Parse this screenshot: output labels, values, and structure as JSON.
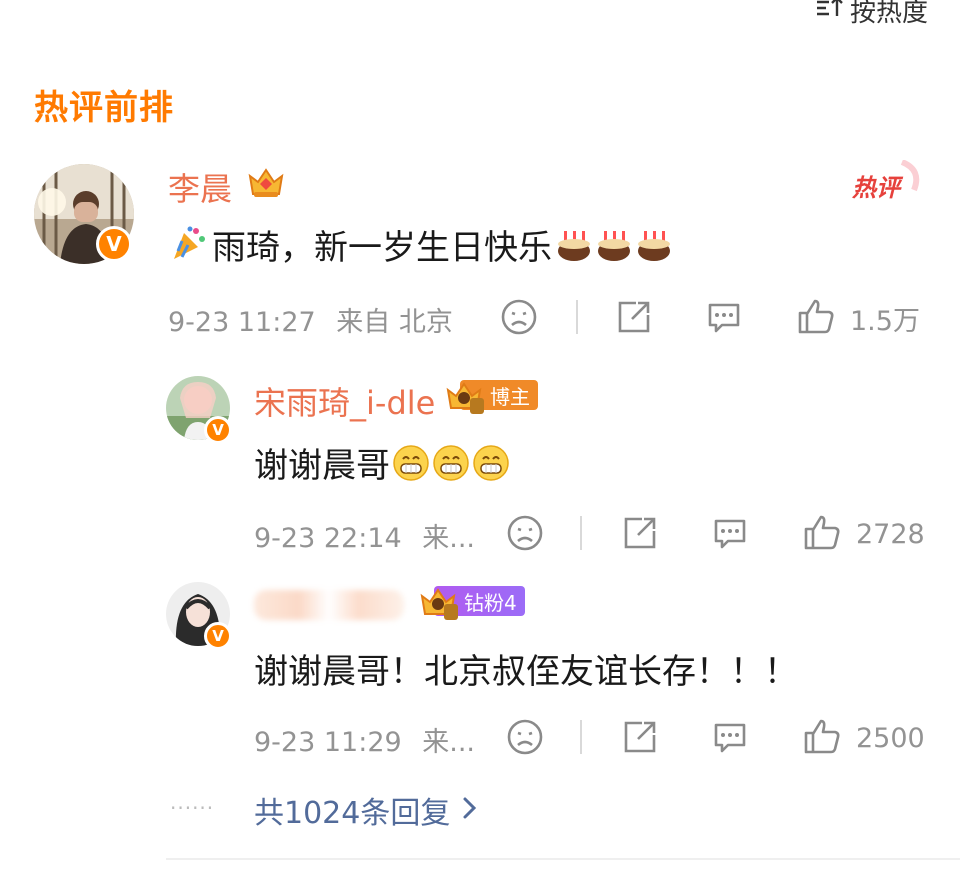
{
  "sort": {
    "label": "按热度"
  },
  "section": {
    "title": "热评前排"
  },
  "main_comment": {
    "username": "李晨",
    "hot_label": "热评",
    "text": "雨琦，新一岁生日快乐",
    "time": "9-23 11:27",
    "source": "来自 北京",
    "likes": "1.5万"
  },
  "replies": [
    {
      "username": "宋雨琦_i-dle",
      "badge": "博主",
      "text": "谢谢晨哥",
      "time": "9-23 22:14",
      "source": "来...",
      "likes": "2728"
    },
    {
      "badge": "钻粉4",
      "text": "谢谢晨哥！北京叔侄友谊长存！！！",
      "time": "9-23 11:29",
      "source": "来...",
      "likes": "2500"
    }
  ],
  "more_replies": {
    "label": "共1024条回复",
    "dots": "······"
  },
  "colors": {
    "accent": "#ff7a00",
    "username": "#eb7350",
    "link": "#526b9a",
    "meta": "#939393"
  }
}
